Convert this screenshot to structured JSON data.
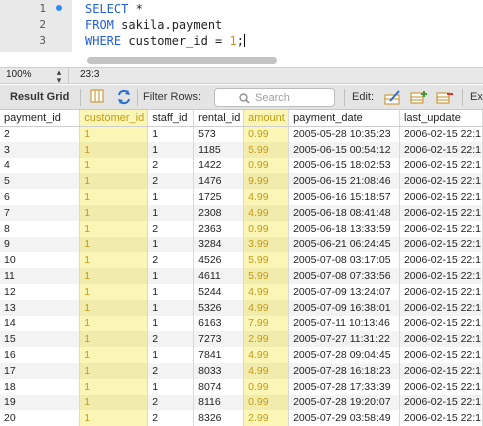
{
  "editor": {
    "lines": [
      {
        "num": "1",
        "parts": [
          {
            "t": "SELECT",
            "c": "kw"
          },
          {
            "t": " *",
            "c": "tx"
          }
        ]
      },
      {
        "num": "2",
        "parts": [
          {
            "t": "FROM",
            "c": "kw"
          },
          {
            "t": " sakila.payment",
            "c": "tx"
          }
        ]
      },
      {
        "num": "3",
        "parts": [
          {
            "t": "WHERE",
            "c": "kw"
          },
          {
            "t": " customer_id = ",
            "c": "tx"
          },
          {
            "t": "1",
            "c": "num-lit"
          },
          {
            "t": ";",
            "c": "tx"
          }
        ]
      }
    ]
  },
  "status": {
    "zoom": "100%",
    "stepper": "◇",
    "cursor": "23:3"
  },
  "toolbar": {
    "result_grid": "Result Grid",
    "filter_rows": "Filter Rows:",
    "search_placeholder": "Search",
    "edit": "Edit:",
    "export": "Ex"
  },
  "grid": {
    "columns": [
      "payment_id",
      "customer_id",
      "staff_id",
      "rental_id",
      "amount",
      "payment_date",
      "last_update"
    ],
    "rows": [
      [
        "2",
        "1",
        "1",
        "573",
        "0.99",
        "2005-05-28 10:35:23",
        "2006-02-15 22:1"
      ],
      [
        "3",
        "1",
        "1",
        "1185",
        "5.99",
        "2005-06-15 00:54:12",
        "2006-02-15 22:1"
      ],
      [
        "4",
        "1",
        "2",
        "1422",
        "0.99",
        "2005-06-15 18:02:53",
        "2006-02-15 22:1"
      ],
      [
        "5",
        "1",
        "2",
        "1476",
        "9.99",
        "2005-06-15 21:08:46",
        "2006-02-15 22:1"
      ],
      [
        "6",
        "1",
        "1",
        "1725",
        "4.99",
        "2005-06-16 15:18:57",
        "2006-02-15 22:1"
      ],
      [
        "7",
        "1",
        "1",
        "2308",
        "4.99",
        "2005-06-18 08:41:48",
        "2006-02-15 22:1"
      ],
      [
        "8",
        "1",
        "2",
        "2363",
        "0.99",
        "2005-06-18 13:33:59",
        "2006-02-15 22:1"
      ],
      [
        "9",
        "1",
        "1",
        "3284",
        "3.99",
        "2005-06-21 06:24:45",
        "2006-02-15 22:1"
      ],
      [
        "10",
        "1",
        "2",
        "4526",
        "5.99",
        "2005-07-08 03:17:05",
        "2006-02-15 22:1"
      ],
      [
        "11",
        "1",
        "1",
        "4611",
        "5.99",
        "2005-07-08 07:33:56",
        "2006-02-15 22:1"
      ],
      [
        "12",
        "1",
        "1",
        "5244",
        "4.99",
        "2005-07-09 13:24:07",
        "2006-02-15 22:1"
      ],
      [
        "13",
        "1",
        "1",
        "5326",
        "4.99",
        "2005-07-09 16:38:01",
        "2006-02-15 22:1"
      ],
      [
        "14",
        "1",
        "1",
        "6163",
        "7.99",
        "2005-07-11 10:13:46",
        "2006-02-15 22:1"
      ],
      [
        "15",
        "1",
        "2",
        "7273",
        "2.99",
        "2005-07-27 11:31:22",
        "2006-02-15 22:1"
      ],
      [
        "16",
        "1",
        "1",
        "7841",
        "4.99",
        "2005-07-28 09:04:45",
        "2006-02-15 22:1"
      ],
      [
        "17",
        "1",
        "2",
        "8033",
        "4.99",
        "2005-07-28 16:18:23",
        "2006-02-15 22:1"
      ],
      [
        "18",
        "1",
        "1",
        "8074",
        "0.99",
        "2005-07-28 17:33:39",
        "2006-02-15 22:1"
      ],
      [
        "19",
        "1",
        "2",
        "8116",
        "0.99",
        "2005-07-28 19:20:07",
        "2006-02-15 22:1"
      ],
      [
        "20",
        "1",
        "2",
        "8326",
        "2.99",
        "2005-07-29 03:58:49",
        "2006-02-15 22:1"
      ]
    ],
    "highlight_columns": [
      1,
      4
    ]
  },
  "colors": {
    "keyword": "#1f5fd8",
    "number_literal": "#d08a2a",
    "highlight_bg": "#fbf6b5",
    "highlight_text": "#c49a17"
  }
}
